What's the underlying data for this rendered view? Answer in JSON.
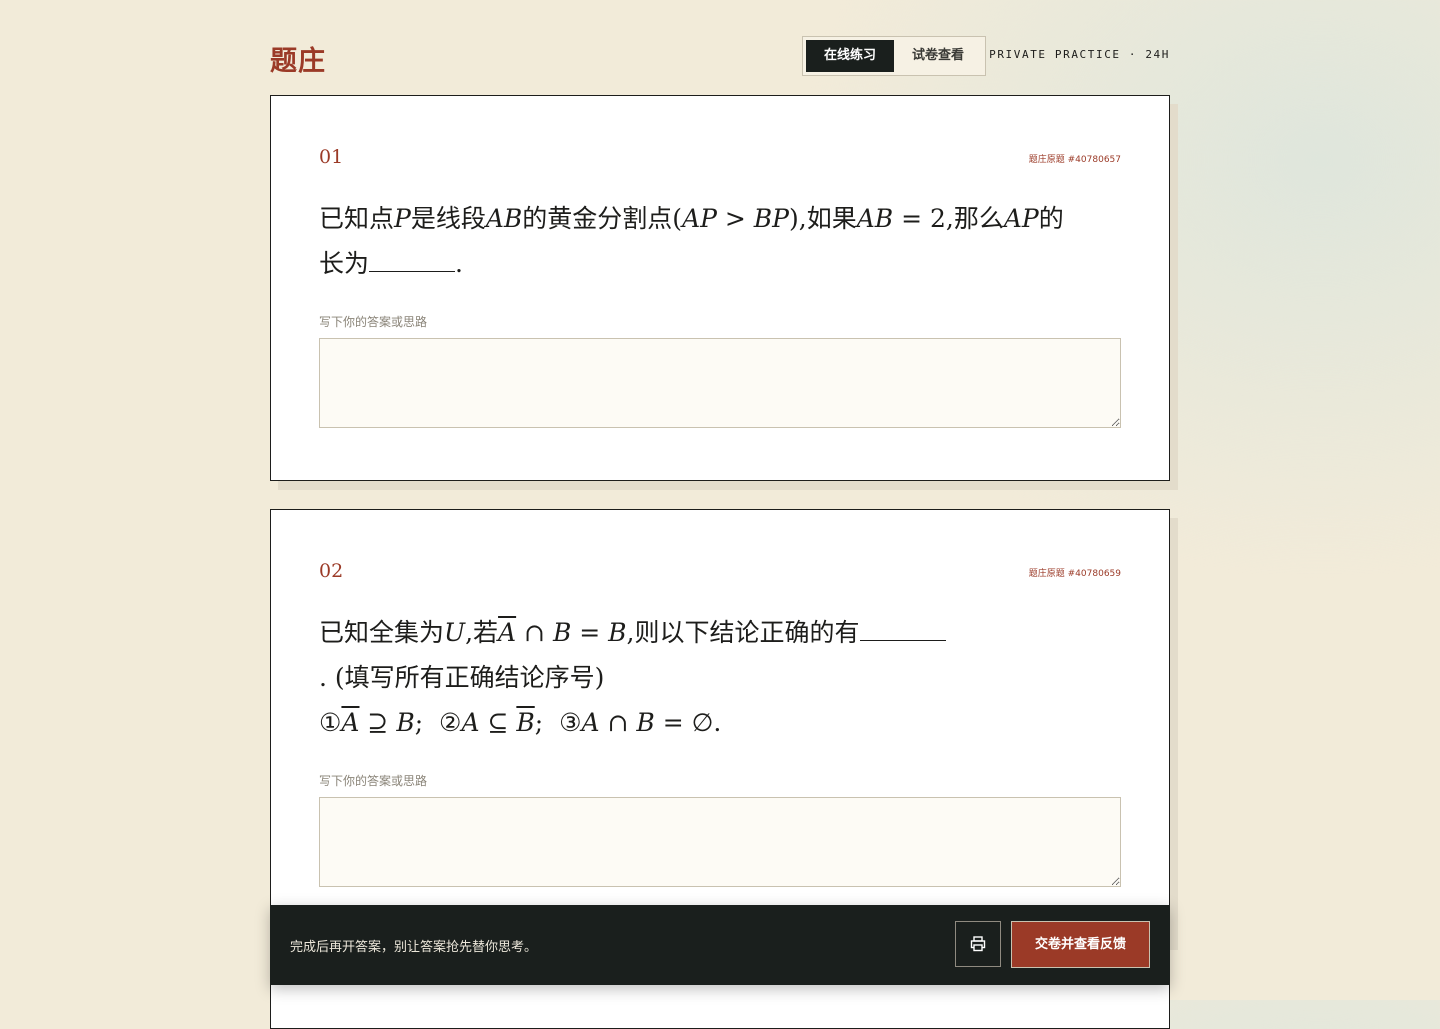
{
  "header": {
    "brand": "题庄",
    "tabs": [
      {
        "label": "在线练习",
        "active": true
      },
      {
        "label": "试卷查看",
        "active": false
      }
    ],
    "tagline": "PRIVATE PRACTICE · 24H"
  },
  "questions": [
    {
      "number": "01",
      "id_label": "题庄原题 #40780657",
      "text": {
        "p1": "已知点",
        "v_P": "P",
        "p2": "是线段",
        "v_AB": "AB",
        "p3": "的黄金分割点(",
        "v_AP": "AP",
        "gt": " > ",
        "v_BP": "BP",
        "p4": "),如果",
        "v_AB2": "AB",
        "eq": " = 2",
        "p5": ",那么",
        "v_AP2": "AP",
        "p6": "的",
        "p7": "长为",
        "end": "."
      },
      "answer_label": "写下你的答案或思路",
      "answer_value": ""
    },
    {
      "number": "02",
      "id_label": "题庄原题 #40780659",
      "text": {
        "p1": "已知全集为",
        "v_U": "U",
        "p2": ",若",
        "v_A": "A",
        "cap": " ∩ ",
        "v_B": "B",
        "eq": " = ",
        "v_B2": "B",
        "p3": ",则以下结论正确的有",
        "line2": ". (填写所有正确结论序号)",
        "c1": "①",
        "c1_A": "A",
        "c1_rel": " ⊇ ",
        "c1_B": "B",
        "c1_end": ";  ",
        "c2": "②",
        "c2_A": "A",
        "c2_rel": " ⊆ ",
        "c2_B": "B",
        "c2_end": ";  ",
        "c3": "③",
        "c3_A": "A",
        "c3_rel": " ∩ ",
        "c3_B": "B",
        "c3_eq": " = ∅."
      },
      "answer_label": "写下你的答案或思路",
      "answer_value": ""
    }
  ],
  "footer": {
    "tip": "完成后再开答案，别让答案抢先替你思考。",
    "print_icon": "printer-icon",
    "submit_label": "交卷并查看反馈"
  },
  "colors": {
    "accent": "#9b3a27",
    "dark": "#1a1f1d",
    "background": "#f2ebd9"
  }
}
